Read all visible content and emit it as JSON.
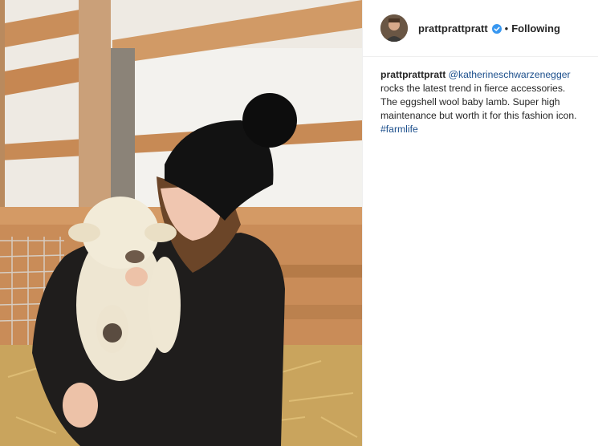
{
  "header": {
    "username": "prattprattpratt",
    "separator": "•",
    "follow_status": "Following"
  },
  "caption": {
    "username": "prattprattpratt",
    "mention": "@katherineschwarzenegger",
    "text": "rocks the latest trend in fierce accessories. The eggshell wool baby lamb. Super high maintenance but worth it for this fashion icon.",
    "hashtag": "#farmlife"
  },
  "colors": {
    "link": "#1c4f8c",
    "verified_badge": "#3897f0",
    "text": "#262626"
  },
  "icons": {
    "verified": "verified-badge-icon"
  }
}
